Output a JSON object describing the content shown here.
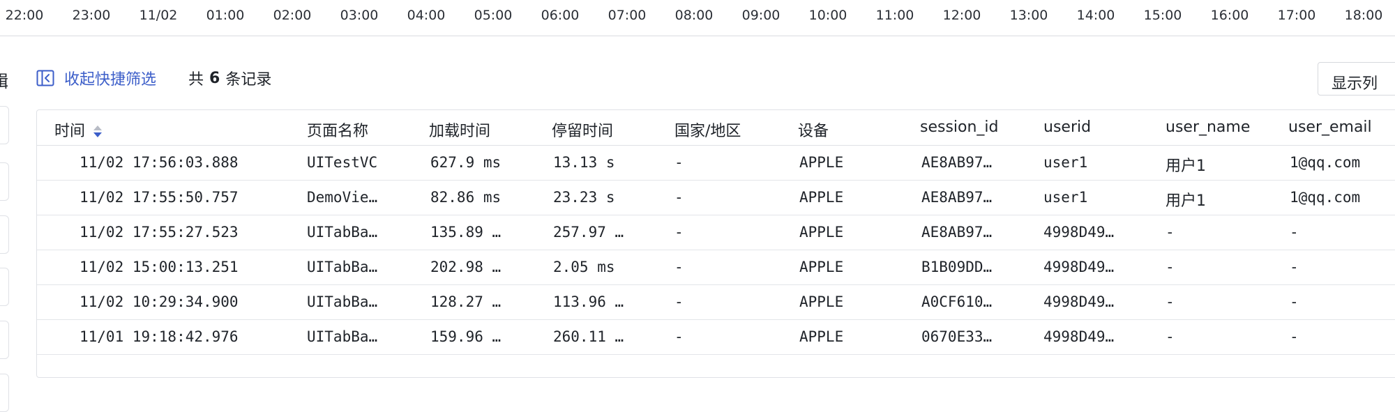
{
  "timeline": {
    "ticks": [
      "22:00",
      "23:00",
      "11/02",
      "01:00",
      "02:00",
      "03:00",
      "04:00",
      "05:00",
      "06:00",
      "07:00",
      "08:00",
      "09:00",
      "10:00",
      "11:00",
      "12:00",
      "13:00",
      "14:00",
      "15:00",
      "16:00",
      "17:00",
      "18:00"
    ]
  },
  "left_panel": {
    "cut_char": "辑"
  },
  "toolbar": {
    "collapse_label": "收起快捷筛选",
    "count_prefix": "共",
    "count_value": "6",
    "count_suffix": "条记录",
    "columns_button": "显示列"
  },
  "table": {
    "headers": [
      "时间",
      "页面名称",
      "加载时间",
      "停留时间",
      "国家/地区",
      "设备",
      "session_id",
      "userid",
      "user_name",
      "user_email"
    ],
    "rows": [
      [
        "11/02 17:56:03.888",
        "UITestVC",
        "627.9 ms",
        "13.13 s",
        "-",
        "APPLE",
        "AE8AB97…",
        "user1",
        "用户1",
        "1@qq.com"
      ],
      [
        "11/02 17:55:50.757",
        "DemoVie…",
        "82.86 ms",
        "23.23 s",
        "-",
        "APPLE",
        "AE8AB97…",
        "user1",
        "用户1",
        "1@qq.com"
      ],
      [
        "11/02 17:55:27.523",
        "UITabBa…",
        "135.89 …",
        "257.97 …",
        "-",
        "APPLE",
        "AE8AB97…",
        "4998D49…",
        "-",
        "-"
      ],
      [
        "11/02 15:00:13.251",
        "UITabBa…",
        "202.98 …",
        "2.05 ms",
        "-",
        "APPLE",
        "B1B09DD…",
        "4998D49…",
        "-",
        "-"
      ],
      [
        "11/02 10:29:34.900",
        "UITabBa…",
        "128.27 …",
        "113.96 …",
        "-",
        "APPLE",
        "A0CF610…",
        "4998D49…",
        "-",
        "-"
      ],
      [
        "11/01 19:18:42.976",
        "UITabBa…",
        "159.96 …",
        "260.11 …",
        "-",
        "APPLE",
        "0670E33…",
        "4998D49…",
        "-",
        "-"
      ]
    ]
  },
  "colors": {
    "accent": "#3c5ec9",
    "sort_active": "#3c5ec9",
    "sort_inactive": "#b8bcc6",
    "border": "#dfe1e6"
  },
  "icons": {
    "collapse": "panel-collapse-left-icon",
    "sort": "sort-arrows-icon"
  }
}
